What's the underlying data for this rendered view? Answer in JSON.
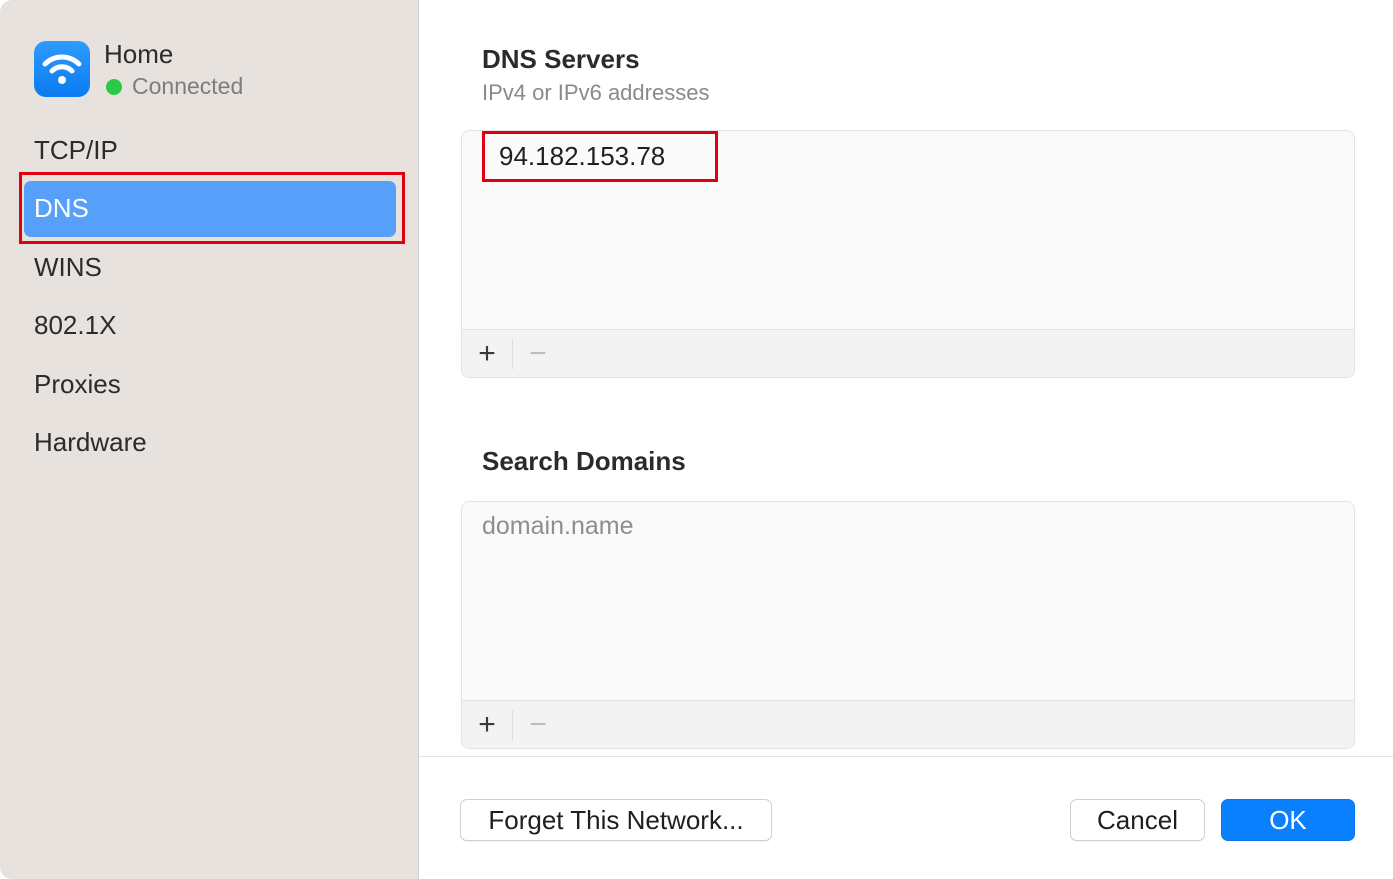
{
  "network": {
    "name": "Home",
    "status": "Connected"
  },
  "sidebar": {
    "items": [
      {
        "label": "TCP/IP"
      },
      {
        "label": "DNS",
        "selected": true
      },
      {
        "label": "WINS"
      },
      {
        "label": "802.1X"
      },
      {
        "label": "Proxies"
      },
      {
        "label": "Hardware"
      }
    ]
  },
  "dns_servers": {
    "title": "DNS Servers",
    "subtitle": "IPv4 or IPv6 addresses",
    "entries": [
      "94.182.153.78"
    ],
    "add_label": "+",
    "remove_label": "−"
  },
  "search_domains": {
    "title": "Search Domains",
    "placeholder": "domain.name",
    "add_label": "+",
    "remove_label": "−"
  },
  "footer": {
    "forget_label": "Forget This Network...",
    "cancel_label": "Cancel",
    "ok_label": "OK"
  },
  "colors": {
    "accent": "#0b80ff",
    "sidebar_selected": "#57a0f9",
    "status_connected": "#29c94a",
    "annotation_highlight": "#e1000f"
  },
  "icons": {
    "network": "wifi-icon",
    "status": "status-dot"
  }
}
